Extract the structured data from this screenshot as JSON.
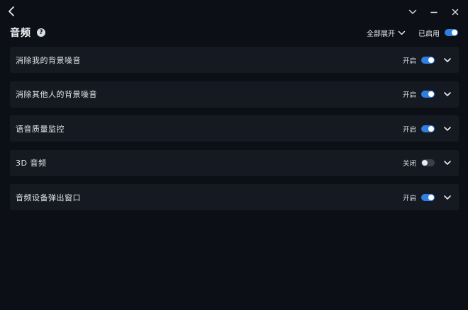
{
  "window": {
    "back_icon": "chevron-left-icon",
    "controls": [
      "chevron-down-icon",
      "minimize-icon",
      "close-icon"
    ]
  },
  "header": {
    "title": "音频",
    "help_icon": "?",
    "expand_all_label": "全部展开",
    "enabled_label": "已启用",
    "enabled": true
  },
  "colors": {
    "toggle_on": "#2f7fe0",
    "toggle_off": "#3a4049",
    "row_bg": "#151a22",
    "window_bg": "#0c1016"
  },
  "settings": [
    {
      "label": "消除我的背景噪音",
      "status": "开启",
      "enabled": true
    },
    {
      "label": "消除其他人的背景噪音",
      "status": "开启",
      "enabled": true
    },
    {
      "label": "语音质量监控",
      "status": "开启",
      "enabled": true
    },
    {
      "label": "3D 音频",
      "status": "关闭",
      "enabled": false
    },
    {
      "label": "音频设备弹出窗口",
      "status": "开启",
      "enabled": true
    }
  ]
}
